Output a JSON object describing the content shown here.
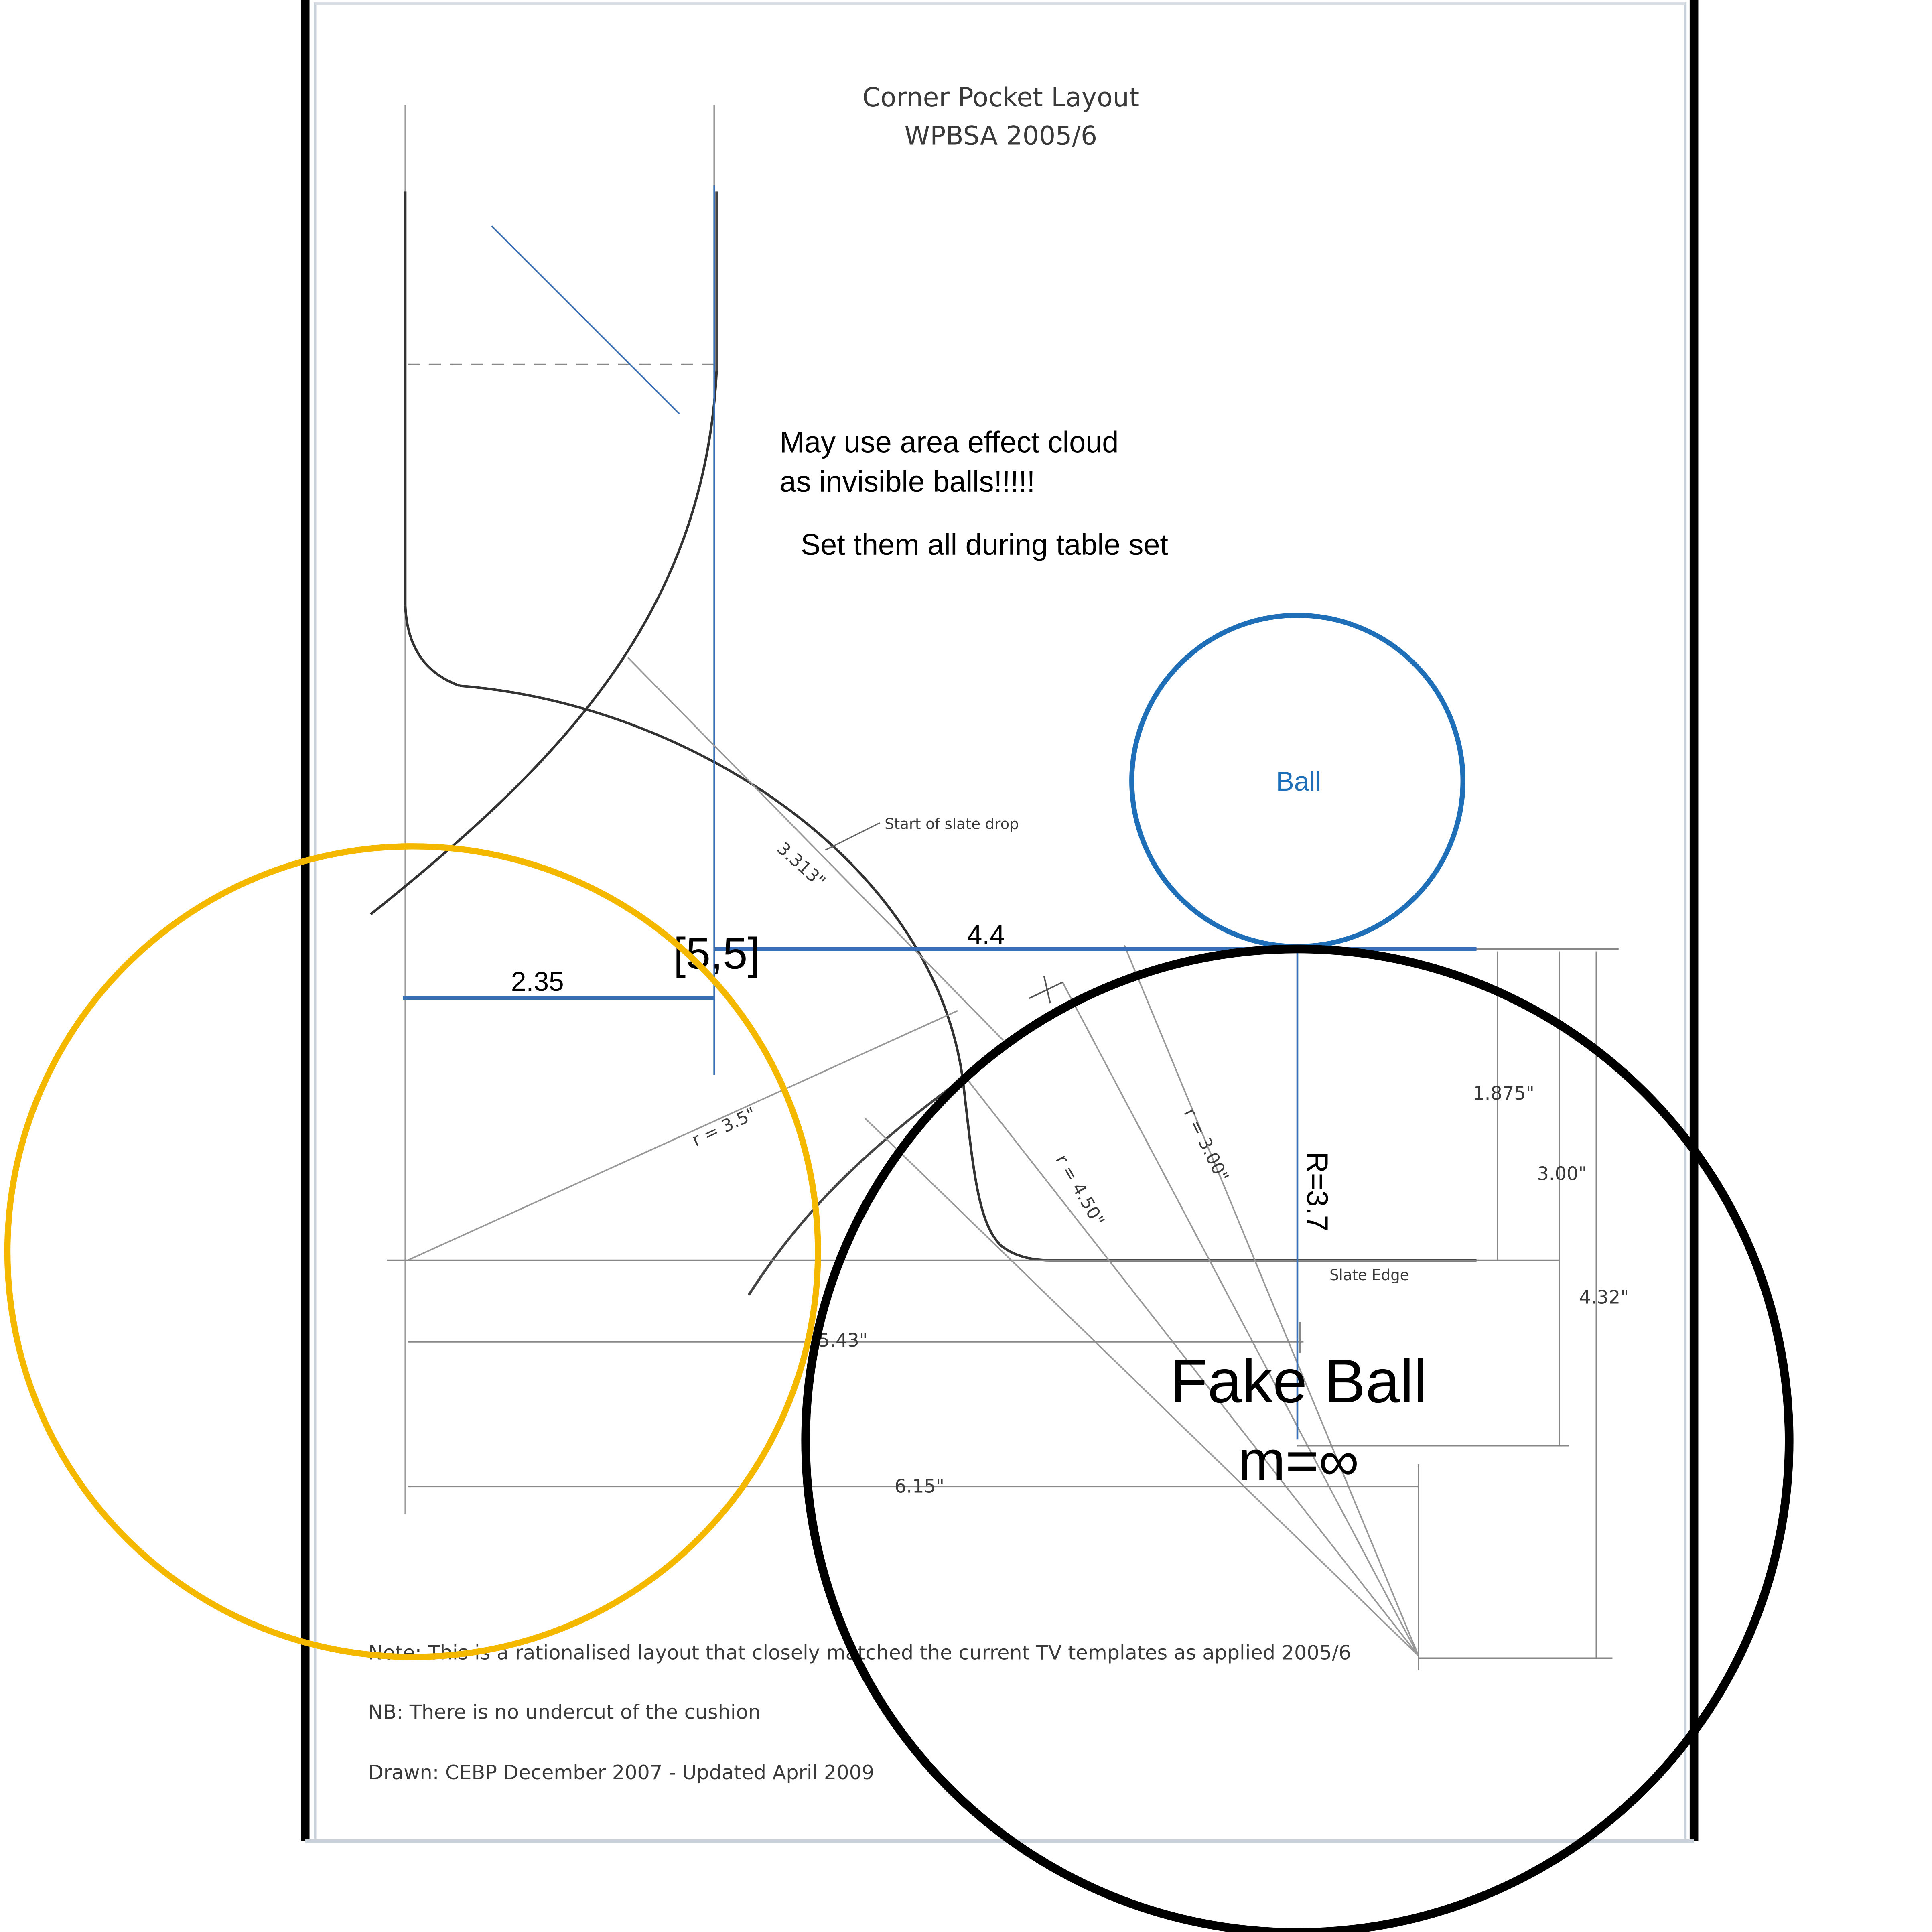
{
  "document": {
    "title_line1": "Corner Pocket Layout",
    "title_line2": "WPBSA 2005/6",
    "note1": "Note: This is a rationalised layout that closely matched the current TV templates as applied 2005/6",
    "note2": "NB: There is no undercut of the cushion",
    "note3": "Drawn: CEBP December 2007 - Updated April 2009"
  },
  "dimensions": {
    "start_slate_drop": "Start of slate drop",
    "arc_3313": "3.313\"",
    "r35": "r = 3.5\"",
    "r450": "r = 4.50\"",
    "r300": "r = 3.00\"",
    "d1875": "1.875\"",
    "d300": "3.00\"",
    "d432": "4.32\"",
    "d543": "5.43\"",
    "d615": "6.15\"",
    "slate_edge": "Slate Edge"
  },
  "annotations": {
    "note_line1": "May use area effect cloud",
    "note_line2": "as invisible balls!!!!!",
    "note_line3": "Set them all during table set",
    "label_2_35": "2.35",
    "label_4_4": "4.4",
    "label_5_5": "[5,5]",
    "ball_label": "Ball",
    "r_label": "R=3.7",
    "fake_ball_line1": "Fake Ball",
    "fake_ball_line2": "m=∞"
  },
  "colors": {
    "ball_blue": "#1f6fb8",
    "line_blue": "#3b6fb5",
    "yellow": "#f5b800",
    "black": "#000000"
  }
}
